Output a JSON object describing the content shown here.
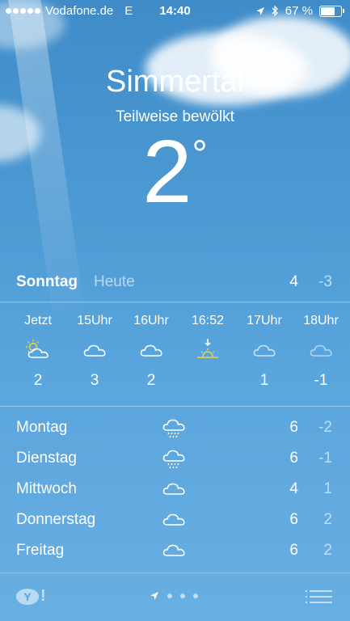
{
  "status_bar": {
    "carrier": "Vodafone.de",
    "network": "E",
    "time": "14:40",
    "battery_percent": "67 %",
    "battery_level": 0.67,
    "icons": [
      "signal-dots-icon",
      "location-arrow-icon",
      "bluetooth-icon",
      "battery-icon"
    ]
  },
  "location": {
    "city": "Simmertal",
    "condition": "Teilweise bewölkt",
    "temperature": "2",
    "degree_symbol": "°"
  },
  "today": {
    "day": "Sonntag",
    "label": "Heute",
    "high": "4",
    "low": "-3"
  },
  "hourly": [
    {
      "time": "Jetzt",
      "icon": "sun-cloud-icon",
      "temp": "2"
    },
    {
      "time": "15Uhr",
      "icon": "cloud-icon",
      "temp": "3"
    },
    {
      "time": "16Uhr",
      "icon": "cloud-icon",
      "temp": "2"
    },
    {
      "time": "16:52",
      "icon": "sunset-icon",
      "temp": ""
    },
    {
      "time": "17Uhr",
      "icon": "cloud-icon",
      "temp": "1"
    },
    {
      "time": "18Uhr",
      "icon": "cloud-icon",
      "temp": "-1"
    }
  ],
  "daily": [
    {
      "day": "Montag",
      "icon": "rain-cloud-icon",
      "high": "6",
      "low": "-2"
    },
    {
      "day": "Dienstag",
      "icon": "rain-cloud-icon",
      "high": "6",
      "low": "-1"
    },
    {
      "day": "Mittwoch",
      "icon": "cloud-icon",
      "high": "4",
      "low": "1"
    },
    {
      "day": "Donnerstag",
      "icon": "cloud-icon",
      "high": "6",
      "low": "2"
    },
    {
      "day": "Freitag",
      "icon": "cloud-icon",
      "high": "6",
      "low": "2"
    }
  ],
  "bottom_bar": {
    "logo_letter": "Y",
    "logo_suffix": "!",
    "icons": [
      "yahoo-logo",
      "location-arrow-icon",
      "page-dot-icon",
      "list-icon"
    ]
  },
  "colors": {
    "sky_top": "#3f8cc9",
    "sky_bottom": "#68afe2",
    "sun_yellow": "#f2d33b"
  }
}
